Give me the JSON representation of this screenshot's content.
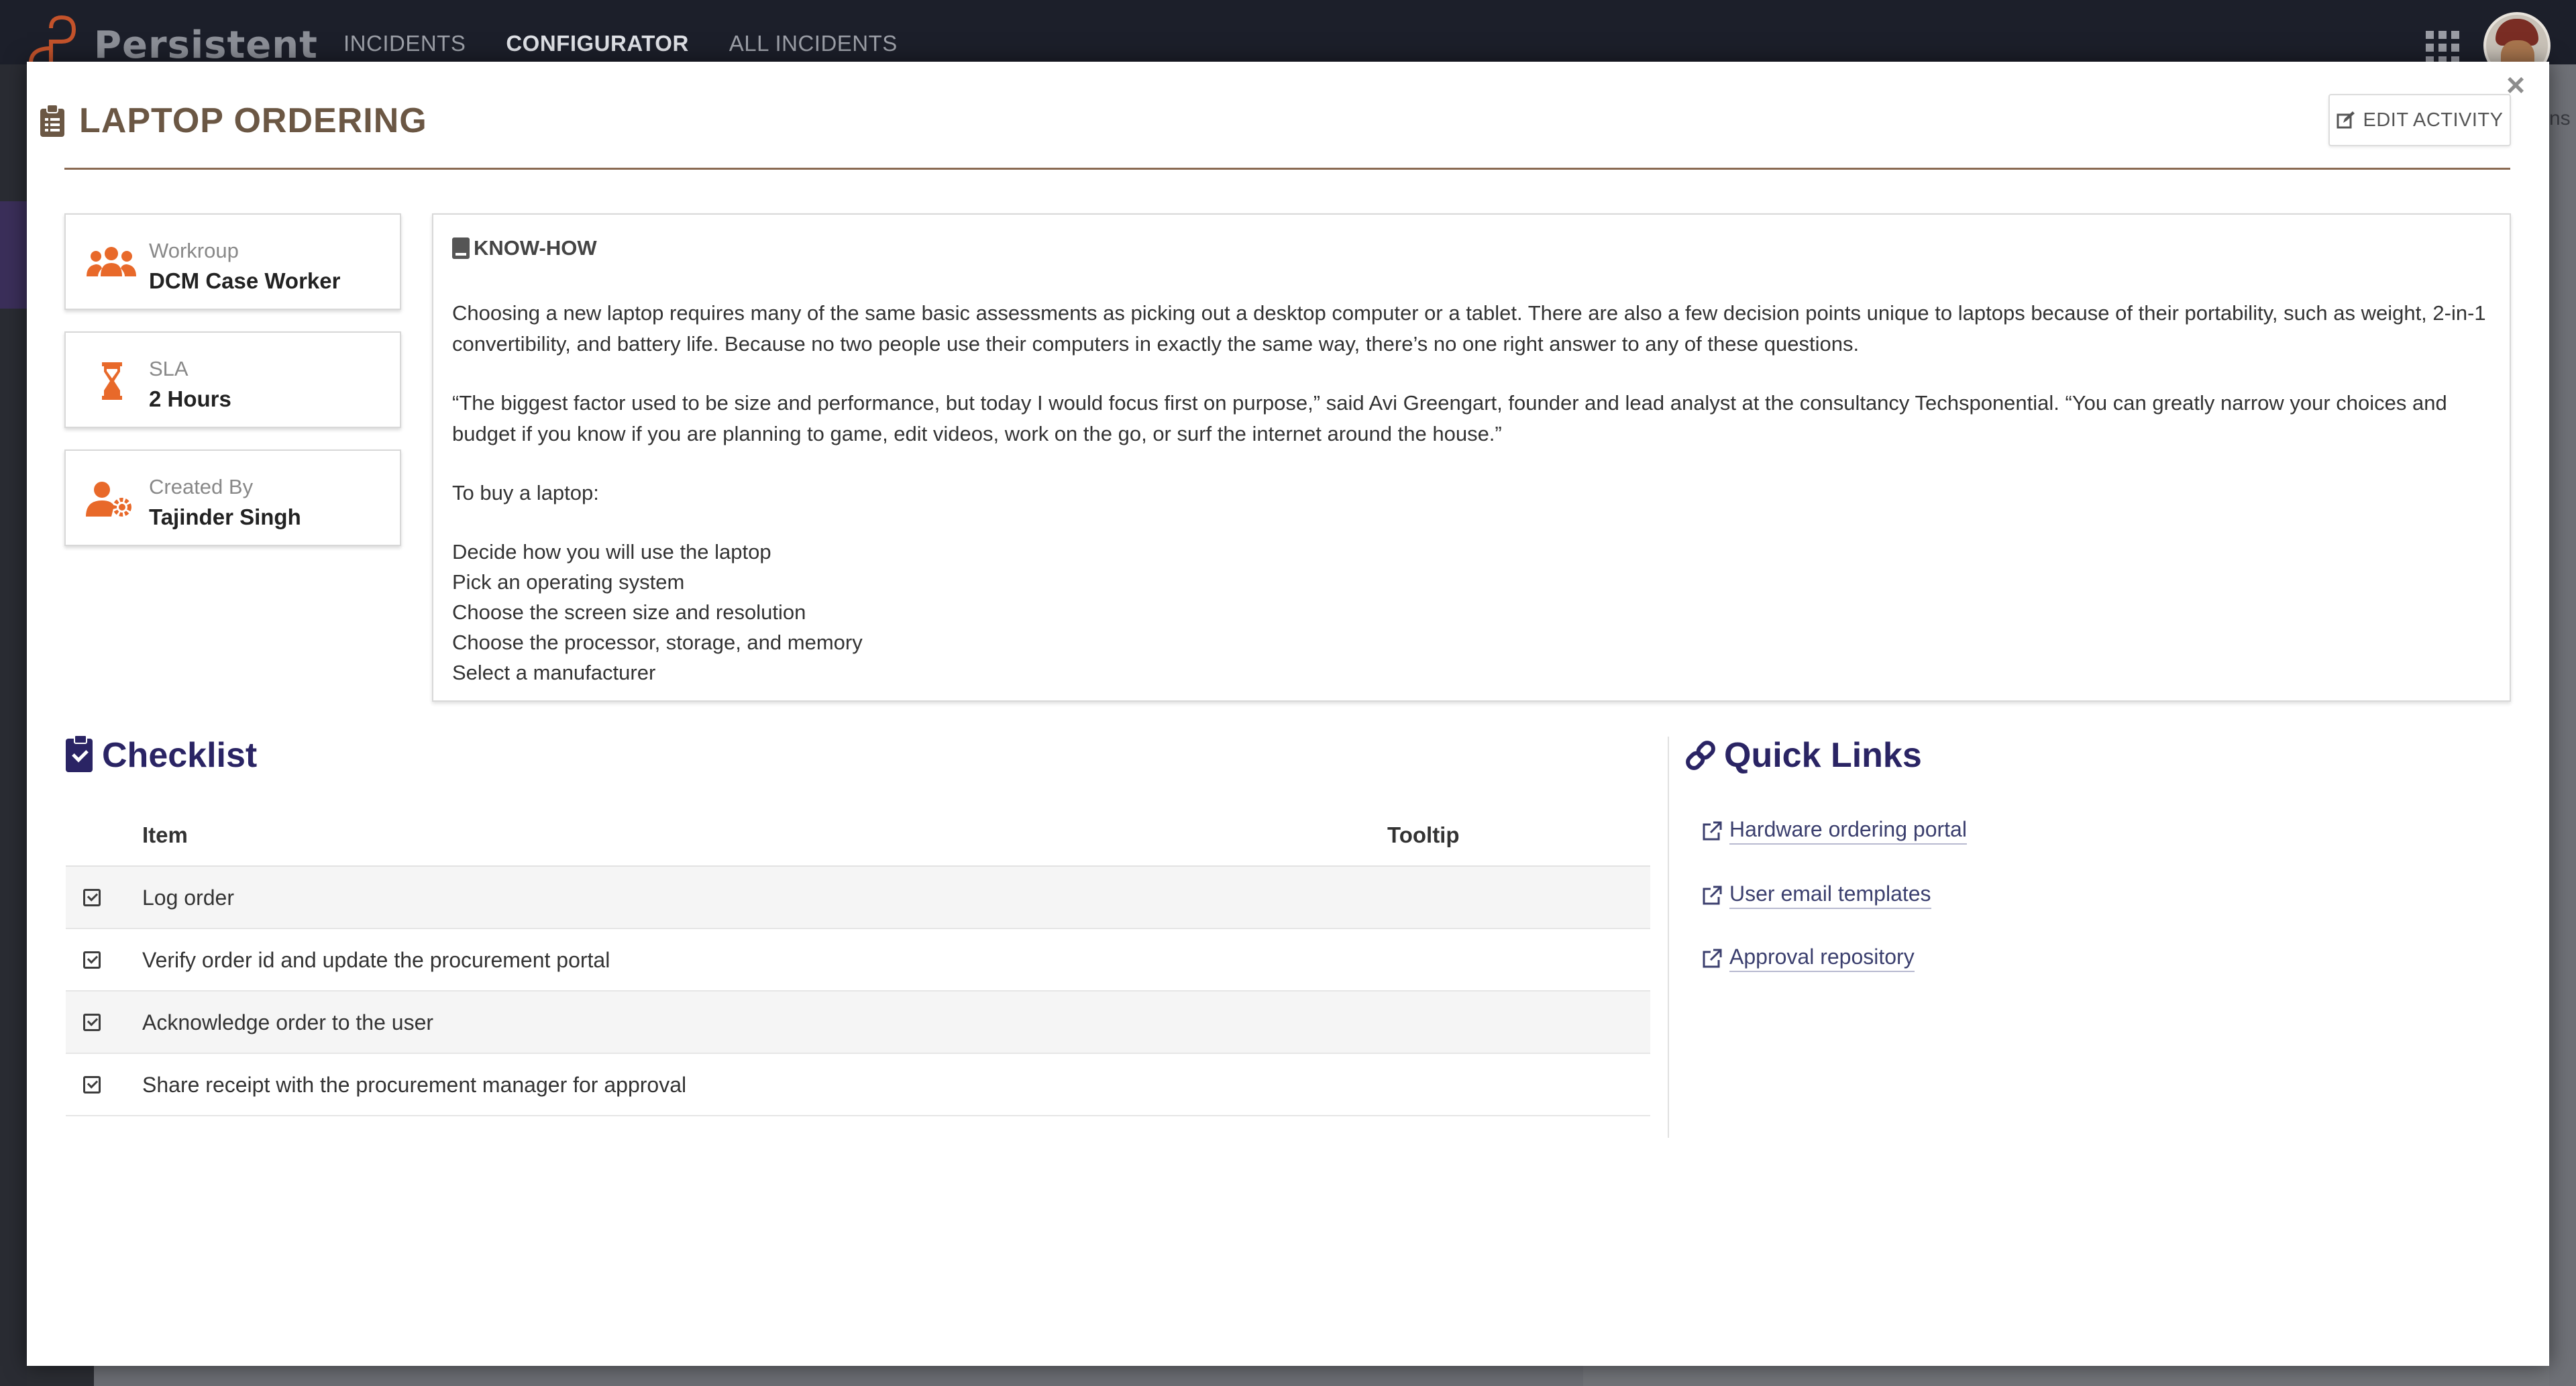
{
  "app": {
    "brand": "Persistent",
    "nav": [
      {
        "label": "INCIDENTS",
        "active": false
      },
      {
        "label": "CONFIGURATOR",
        "active": true
      },
      {
        "label": "ALL INCIDENTS",
        "active": false
      }
    ],
    "right_partial_text": "ns"
  },
  "modal": {
    "title": "LAPTOP ORDERING",
    "edit_button": "EDIT ACTIVITY",
    "close_icon": "close-icon"
  },
  "cards": [
    {
      "label": "Workroup",
      "value": "DCM Case Worker",
      "icon": "users-icon"
    },
    {
      "label": "SLA",
      "value": "2 Hours",
      "icon": "hourglass-icon"
    },
    {
      "label": "Created By",
      "value": "Tajinder Singh",
      "icon": "user-gear-icon"
    }
  ],
  "knowhow": {
    "heading": "KNOW-HOW",
    "p1": "Choosing a new laptop requires many of the same basic assessments as picking out a desktop computer or a tablet. There are also a few decision points unique to laptops because of their portability, such as weight, 2-in-1 convertibility, and battery life. Because no two people use their computers in exactly the same way, there’s no one right answer to any of these questions.",
    "p2": "“The biggest factor used to be size and performance, but today I would focus first on purpose,” said Avi Greengart, founder and lead analyst at the consultancy Techsponential. “You can greatly narrow your choices and budget if you know if you are planning to game, edit videos, work on the go, or surf the internet around the house.”",
    "p3": "To buy a laptop:",
    "steps": [
      "Decide how you will use the laptop",
      "Pick an operating system",
      "Choose the screen size and resolution",
      "Choose the processor, storage, and memory",
      "Select a manufacturer"
    ]
  },
  "checklist": {
    "title": "Checklist",
    "col_item": "Item",
    "col_tooltip": "Tooltip",
    "items": [
      "Log order",
      "Verify order id and update the procurement portal",
      "Acknowledge order to the user",
      "Share receipt with the procurement manager for approval"
    ]
  },
  "quick_links": {
    "title": "Quick Links",
    "links": [
      "Hardware ordering portal",
      "User email templates",
      "Approval repository"
    ]
  },
  "colors": {
    "accent_orange": "#e8692a",
    "title_brown": "#6b5744",
    "section_navy": "#2a2464",
    "topbar": "#1c1f2a"
  }
}
